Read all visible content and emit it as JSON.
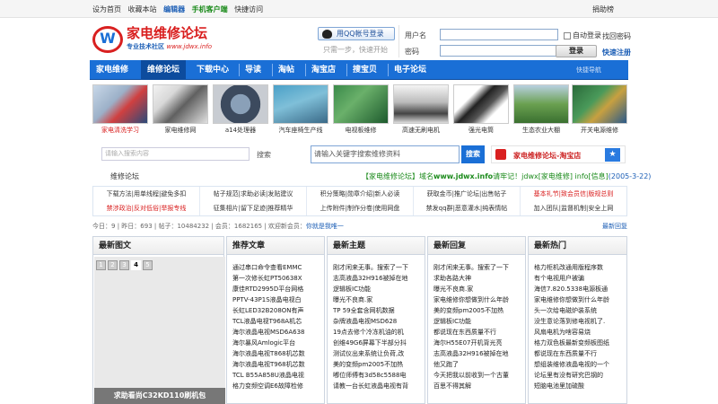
{
  "topbar": {
    "home": "设为首页",
    "favorite": "收藏本站",
    "editor": "编辑器",
    "mobile": "手机客户端",
    "quick": "快捷访问",
    "donate": "捐助榜"
  },
  "logo": {
    "mark": "W",
    "title": "家电维修论坛",
    "sub": "专业技术社区",
    "url": "www.jdwx.info"
  },
  "qq": {
    "label": "用QQ帐号登录",
    "hint": "只需一步，快速开始"
  },
  "login": {
    "user_label": "用户名",
    "pass_label": "密码",
    "auto": "自动登录",
    "find": "找回密码",
    "button": "登录",
    "register": "快速注册"
  },
  "nav": {
    "items": [
      "家电维修",
      "维修论坛",
      "下载中心",
      "导读",
      "淘帖",
      "淘宝店",
      "搜宝贝",
      "电子论坛"
    ],
    "active": 1,
    "sub": "快捷导航"
  },
  "thumbs": [
    {
      "caption": "家电清洗学习",
      "red": true
    },
    {
      "caption": "家电维修网"
    },
    {
      "caption": "a14处理器"
    },
    {
      "caption": "汽车座椅生产线"
    },
    {
      "caption": "电视板维修"
    },
    {
      "caption": "高速无刷电机"
    },
    {
      "caption": "强光电筒"
    },
    {
      "caption": "生态农业大棚"
    },
    {
      "caption": "开关电源维修"
    }
  ],
  "search": {
    "small_placeholder": "请输入搜索内容",
    "small_button": "搜索",
    "main_placeholder": "请输入关键字搜索维修资料",
    "main_button": "搜索"
  },
  "shop": {
    "label": "家电维修论坛-淘宝店",
    "star": "★"
  },
  "forum_row": {
    "left": "维修论坛",
    "notice_a": "【家电维修论坛】域名",
    "notice_b": "www.jdwx.info",
    "notice_c": "请牢记！jdwx[家电维修] info[信息]",
    "notice_d": "(2005-3-22)"
  },
  "grid": {
    "row1": [
      "下载方法|用单线程|避免多扣",
      "帖子规范|求助必读|发贴建议",
      "积分策略|勋章介绍|新人必读",
      "获取金币|推广论坛|出售帖子",
      "基本礼节|致会员信|版规总则"
    ],
    "row2": [
      "禁涉政治|反对低俗|举报专线",
      "征集相片|留下足迹|推荐精华",
      "上传附件|制作分卷|使用网盘",
      "禁发qq群|恶意灌水|纯表情帖",
      "加入团队|监督机制|安全上网"
    ]
  },
  "stats": {
    "today_label": "今日：",
    "today": "9",
    "yesterday_label": "昨日：",
    "yesterday": "693",
    "posts_label": "帖子：",
    "posts": "10484232",
    "members_label": "会员：",
    "members": "1682165",
    "welcome": "欢迎新会员：",
    "newuser": "你就是我唯一",
    "more": "最新回复"
  },
  "panels": {
    "pics": {
      "title": "最新图文",
      "pages": [
        "1",
        "2",
        "3",
        "4",
        "5"
      ],
      "current": 3,
      "caption": "求助看尚C32KD110刷机包"
    },
    "recommend": {
      "title": "推荐文章",
      "items": [
        "通过串口命令查看EMMC",
        "第一次修长虹PT50638X",
        "康佳RTD2995D平台网格",
        "PPTV-43P1S液晶电视白",
        "长虹LED32B208ON有声",
        "TCL液晶电视T968A机芯",
        "海尔液晶电视MSD6A638",
        "海尔暴风Amlogic平台",
        "海尔液晶电视T868机芯数",
        "海尔液晶电视T968机芯数",
        "TCL B55A858U液晶电视",
        "格力变频空调E6故障检修"
      ]
    },
    "topics": {
      "title": "最新主题",
      "items": [
        "刚才闲来无事。搜索了一下",
        "志高液晶32H916被掉在地",
        "逻辑板IC功能",
        "曝光不良商.家",
        "TP 59全套含网机数据",
        "杂牌液晶电视MSD628",
        "19点去修个冷冻机油的机",
        "创维49G6屏幕下半部分抖",
        "测试仪出来系统让负荷,改",
        "美的变频pm2005不加热",
        "嘟位师傅有3d58c5588电",
        "请教一台长虹液晶电视有背"
      ]
    },
    "replies": {
      "title": "最新回复",
      "items": [
        "刚才闲来无事。搜索了一下",
        "求助各路大神",
        "曝光不良商.家",
        "家电维修你想做到什么年龄",
        "美的变频pm2005不加热",
        "逻辑板IC功能",
        "都说现在东西质量不行",
        "海尔H55E07开机背光亮",
        "志高液晶32H916被掉在地",
        "他又跑了",
        "今天把我以前收到一个古董",
        "百思不得其解"
      ]
    },
    "hot": {
      "title": "最新热门",
      "items": [
        "格力柜机改通用版程序数",
        "有个电视用户被骗",
        "海信7.820.5338电源板通",
        "家电维修你想做到什么年龄",
        "头一次给电磁炉装系统",
        "没生意论落到修电视机了.",
        "风扇电机为啥容易烧",
        "格力双色板最新变频板图纸",
        "都说现在东西质量不行",
        "想组装维修液晶电视的一个",
        "论坛里有没有研究巴钢的",
        "短脑电池里加硫酸"
      ]
    }
  }
}
